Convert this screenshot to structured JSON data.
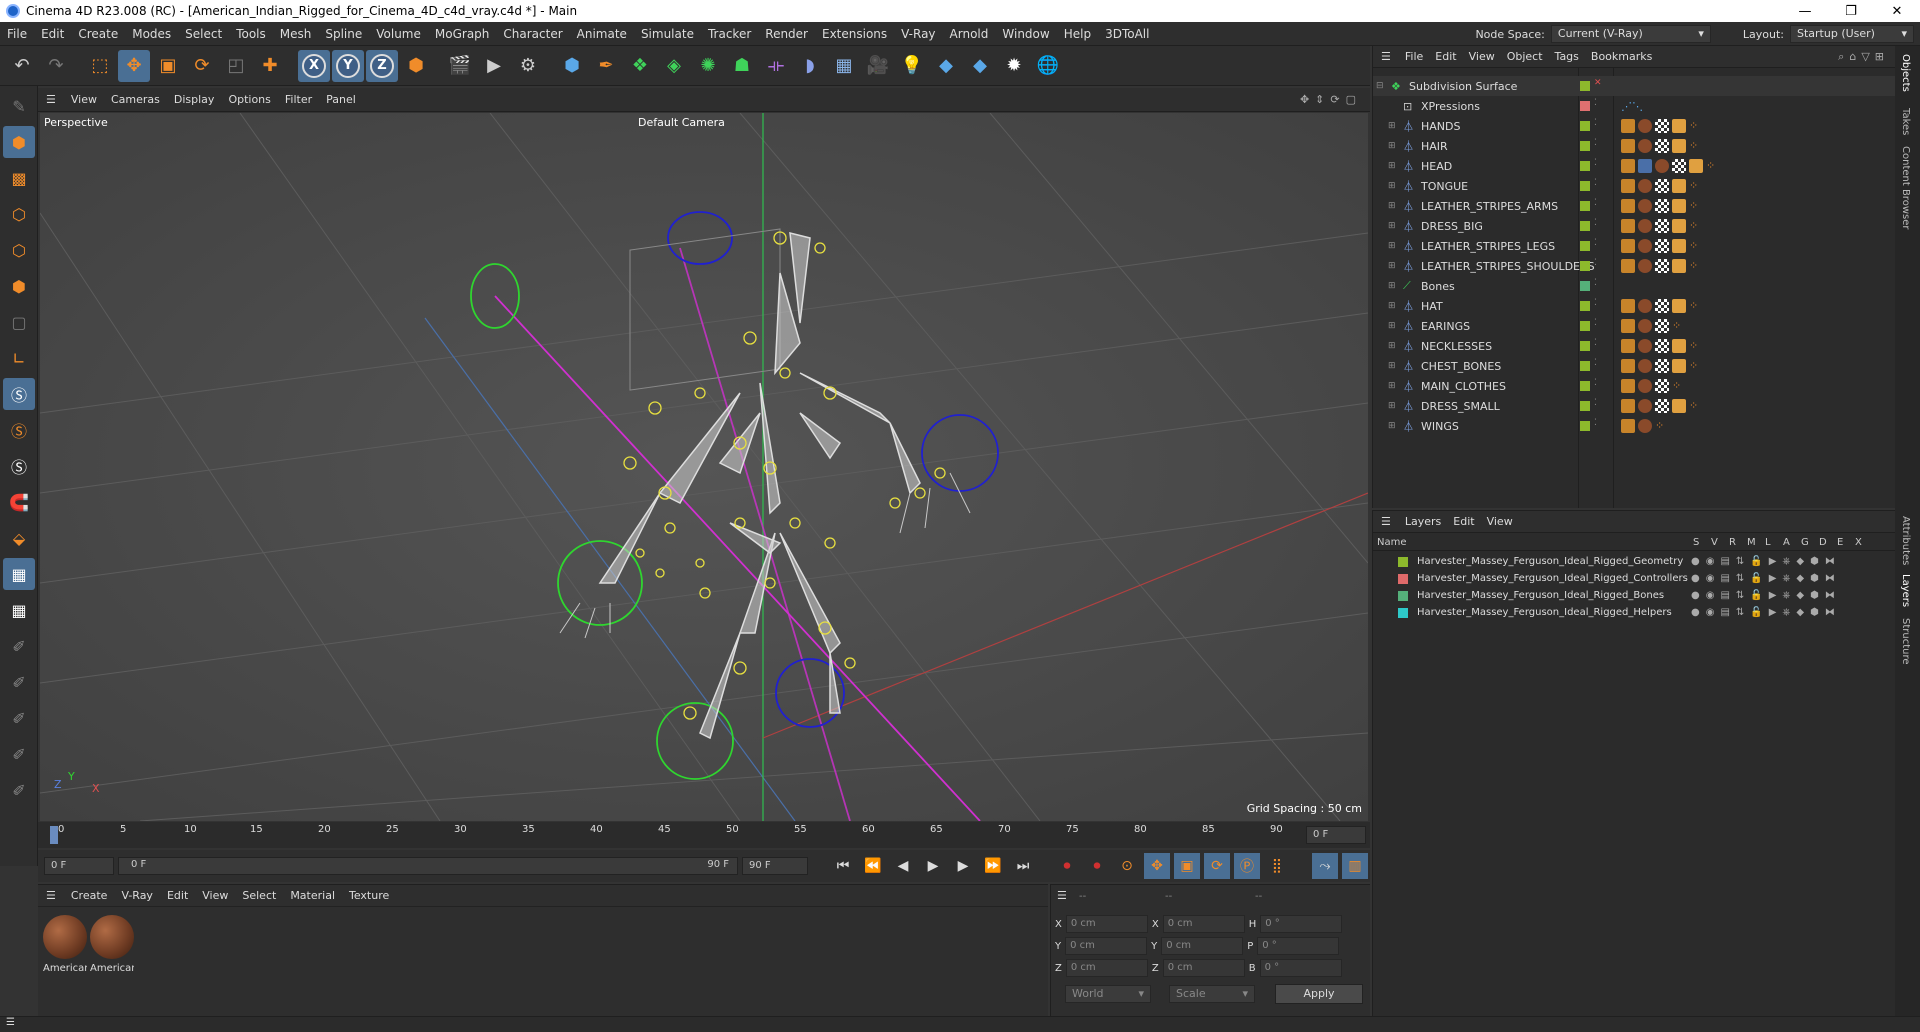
{
  "window": {
    "title": "Cinema 4D R23.008 (RC) - [American_Indian_Rigged_for_Cinema_4D_c4d_vray.c4d *] - Main"
  },
  "menu": [
    "File",
    "Edit",
    "Create",
    "Modes",
    "Select",
    "Tools",
    "Mesh",
    "Spline",
    "Volume",
    "MoGraph",
    "Character",
    "Animate",
    "Simulate",
    "Tracker",
    "Render",
    "Extensions",
    "V-Ray",
    "Arnold",
    "Window",
    "Help",
    "3DToAll"
  ],
  "node_space": {
    "label": "Node Space:",
    "value": "Current (V-Ray)"
  },
  "layout": {
    "label": "Layout:",
    "value": "Startup (User)"
  },
  "viewport_menu": [
    "View",
    "Cameras",
    "Display",
    "Options",
    "Filter",
    "Panel"
  ],
  "viewport": {
    "name": "Perspective",
    "camera": "Default Camera",
    "grid_spacing": "Grid Spacing : 50 cm",
    "axis_y": "Y",
    "axis_x": "X",
    "axis_z": "Z"
  },
  "timeline": {
    "ticks": [
      "0",
      "5",
      "10",
      "15",
      "20",
      "25",
      "30",
      "35",
      "40",
      "45",
      "50",
      "55",
      "60",
      "65",
      "70",
      "75",
      "80",
      "85",
      "90"
    ],
    "current_frame": "0 F"
  },
  "transport": {
    "start": "0 F",
    "current": "0 F",
    "end_field": "90 F",
    "end": "90 F"
  },
  "material_menu": [
    "Create",
    "V-Ray",
    "Edit",
    "View",
    "Select",
    "Material",
    "Texture"
  ],
  "materials": [
    {
      "name": "American"
    },
    {
      "name": "American"
    }
  ],
  "coords": {
    "header1": "--",
    "header2": "--",
    "header3": "--",
    "rows": [
      {
        "a": "X",
        "av": "0 cm",
        "b": "X",
        "bv": "0 cm",
        "c": "H",
        "cv": "0 °"
      },
      {
        "a": "Y",
        "av": "0 cm",
        "b": "Y",
        "bv": "0 cm",
        "c": "P",
        "cv": "0 °"
      },
      {
        "a": "Z",
        "av": "0 cm",
        "b": "Z",
        "bv": "0 cm",
        "c": "B",
        "cv": "0 °"
      }
    ],
    "space": "World",
    "mode": "Scale",
    "apply": "Apply"
  },
  "objects_menu": [
    "File",
    "Edit",
    "View",
    "Object",
    "Tags",
    "Bookmarks"
  ],
  "objects": [
    {
      "name": "Subdivision Surface",
      "color": "#8db92c"
    },
    {
      "name": "XPressions",
      "color": "#e07070"
    },
    {
      "name": "HANDS",
      "color": "#8db92c"
    },
    {
      "name": "HAIR",
      "color": "#8db92c"
    },
    {
      "name": "HEAD",
      "color": "#8db92c"
    },
    {
      "name": "TONGUE",
      "color": "#8db92c"
    },
    {
      "name": "LEATHER_STRIPES_ARMS",
      "color": "#8db92c"
    },
    {
      "name": "DRESS_BIG",
      "color": "#8db92c"
    },
    {
      "name": "LEATHER_STRIPES_LEGS",
      "color": "#8db92c"
    },
    {
      "name": "LEATHER_STRIPES_SHOULDERS",
      "color": "#8db92c"
    },
    {
      "name": "Bones",
      "color": "#55b07a"
    },
    {
      "name": "HAT",
      "color": "#8db92c"
    },
    {
      "name": "EARINGS",
      "color": "#8db92c"
    },
    {
      "name": "NECKLESSES",
      "color": "#8db92c"
    },
    {
      "name": "CHEST_BONES",
      "color": "#8db92c"
    },
    {
      "name": "MAIN_CLOTHES",
      "color": "#8db92c"
    },
    {
      "name": "DRESS_SMALL",
      "color": "#8db92c"
    },
    {
      "name": "WINGS",
      "color": "#8db92c"
    }
  ],
  "layers_menu": [
    "Layers",
    "Edit",
    "View"
  ],
  "layer_columns": {
    "name": "Name",
    "flags": [
      "S",
      "V",
      "R",
      "M",
      "L",
      "A",
      "G",
      "D",
      "E",
      "X"
    ]
  },
  "layers": [
    {
      "name": "Harvester_Massey_Ferguson_Ideal_Rigged_Geometry",
      "color": "#8db92c"
    },
    {
      "name": "Harvester_Massey_Ferguson_Ideal_Rigged_Controllers",
      "color": "#e06a6a"
    },
    {
      "name": "Harvester_Massey_Ferguson_Ideal_Rigged_Bones",
      "color": "#55b07a"
    },
    {
      "name": "Harvester_Massey_Ferguson_Ideal_Rigged_Helpers",
      "color": "#2ec9c9"
    }
  ],
  "side_tabs": [
    "Objects",
    "Takes",
    "Content Browser",
    "Attributes",
    "Layers",
    "Structure"
  ]
}
